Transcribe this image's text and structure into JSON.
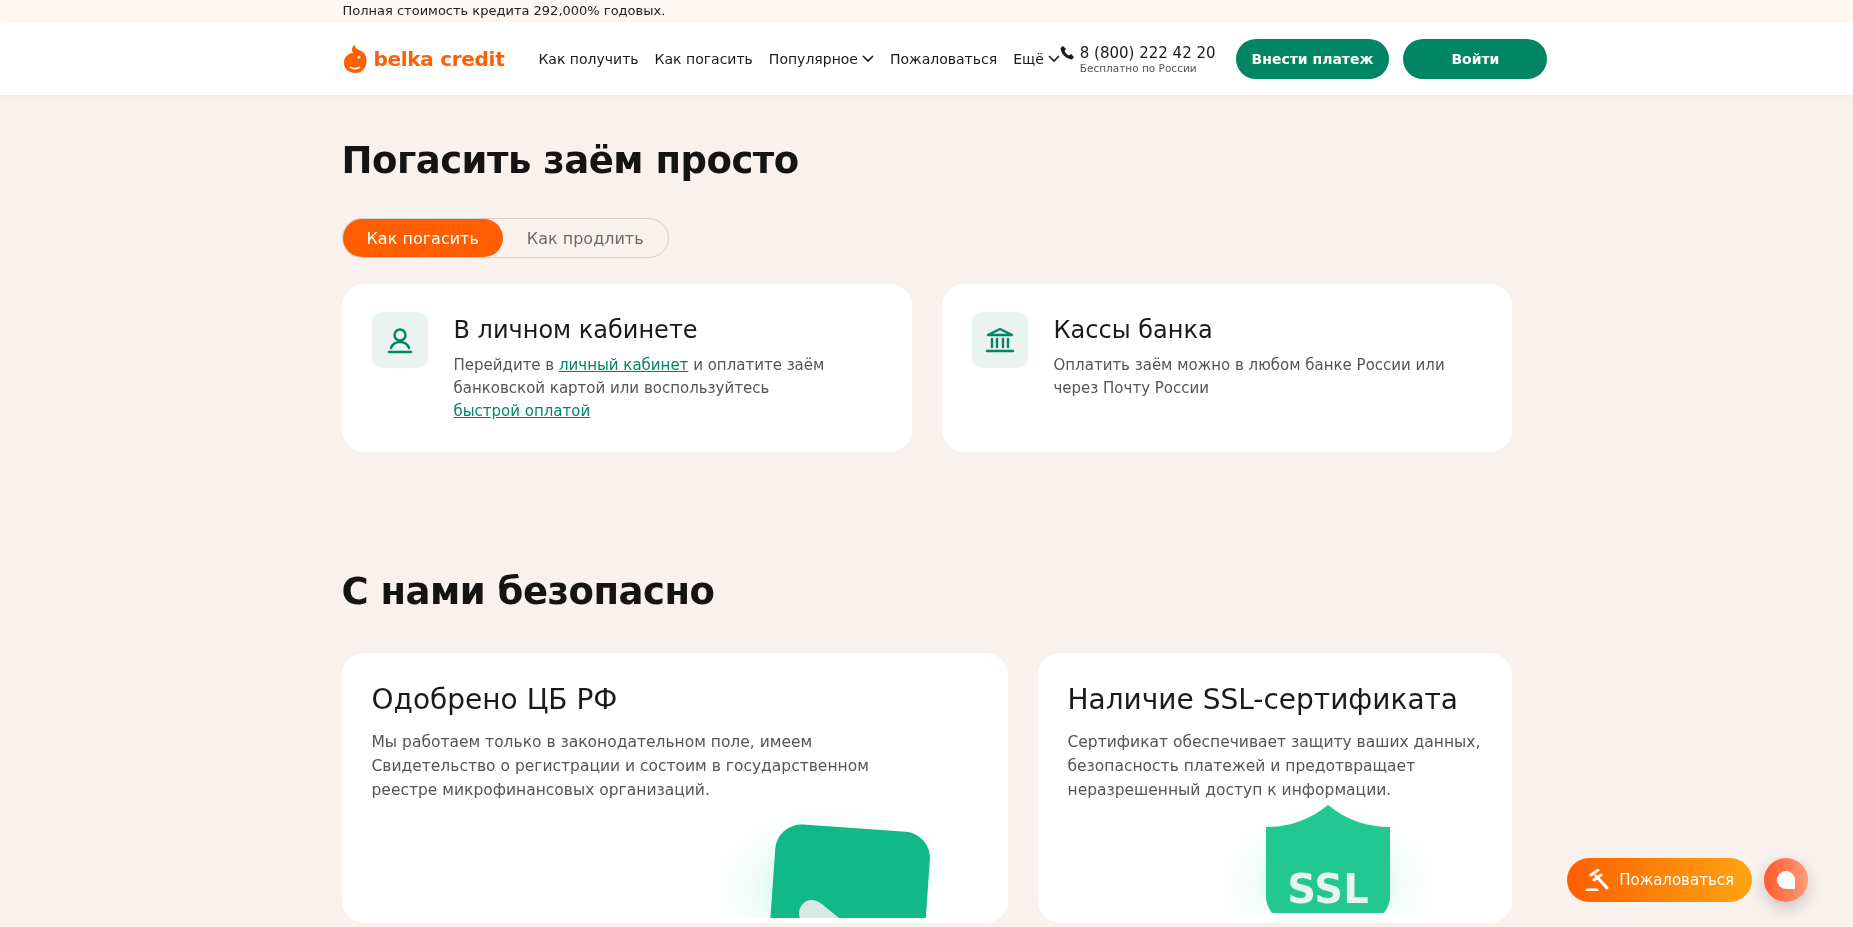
{
  "top_notice": "Полная стоимость кредита 292,000% годовых.",
  "header": {
    "logo": "belka credit",
    "nav": [
      {
        "label": "Как получить",
        "kind": "link"
      },
      {
        "label": "Как погасить",
        "kind": "link"
      },
      {
        "label": "Популярное",
        "kind": "dropdown"
      },
      {
        "label": "Пожаловаться",
        "kind": "link"
      },
      {
        "label": "Ещё",
        "kind": "dropdown"
      }
    ],
    "phone": "8 (800) 222 42 20",
    "phone_note": "Бесплатно по России",
    "buttons": [
      "Внести платеж",
      "Войти"
    ]
  },
  "title": "Погасить заём просто",
  "tabs": [
    {
      "label": "Как погасить",
      "selected": true
    },
    {
      "label": "Как продлить",
      "selected": false
    }
  ],
  "methods": [
    {
      "title": "В личном кабинете",
      "text": [
        {
          "kind": "plain",
          "text": "Перейдите в "
        },
        {
          "kind": "link",
          "text": "личный кабинет"
        },
        {
          "kind": "plain",
          "text": " и оплатите заём банковской картой или воспользуйтесь "
        },
        {
          "kind": "link",
          "text": "быстрой оплатой"
        }
      ]
    },
    {
      "title": "Кассы банка",
      "text": [
        {
          "kind": "plain",
          "text": "Оплатить заём можно в любом банке России или через Почту России"
        }
      ]
    }
  ],
  "safety_title": "С нами безопасно",
  "safety": [
    {
      "title": "Одобрено ЦБ РФ",
      "text": "Мы работаем только в законодательном поле, имеем Свидетельство о регистрации и состоим в государственном реестре микрофинансовых организаций."
    },
    {
      "title": "Наличие SSL-сертификата",
      "text": "Сертификат обеспечивает защиту ваших данных, безопасность платежей и предотвращает неразрешенный доступ к информации.",
      "art_text": "SSL"
    }
  ],
  "complaint_button": "Пожаловаться"
}
